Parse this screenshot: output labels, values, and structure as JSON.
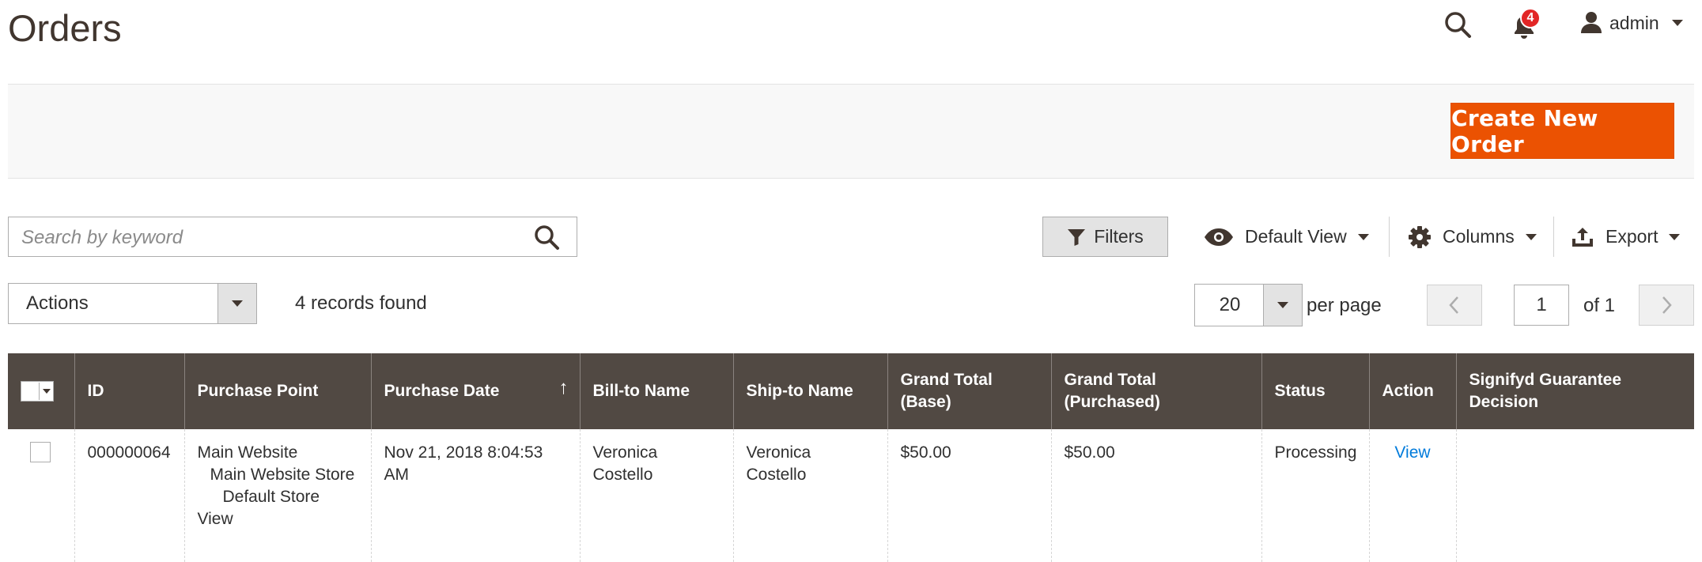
{
  "header": {
    "title": "Orders",
    "notifications_count": "4",
    "user_name": "admin"
  },
  "actions": {
    "create_button": "Create New Order"
  },
  "search": {
    "placeholder": "Search by keyword"
  },
  "toolbar": {
    "filters": "Filters",
    "view": "Default View",
    "columns": "Columns",
    "export": "Export"
  },
  "mass_actions": {
    "label": "Actions"
  },
  "records_found": "4 records found",
  "pager": {
    "per_page": "20",
    "per_page_label": "per page",
    "current_page": "1",
    "total_label": "of 1"
  },
  "grid": {
    "columns": [
      "ID",
      "Purchase Point",
      "Purchase Date",
      "Bill-to Name",
      "Ship-to Name",
      "Grand Total (Base)",
      "Grand Total (Purchased)",
      "Status",
      "Action",
      "Signifyd Guarantee Decision"
    ],
    "rows": [
      {
        "id": "000000064",
        "purchase_point": [
          "Main Website",
          "Main Website Store",
          "Default Store",
          "View"
        ],
        "purchase_date": "Nov 21, 2018 8:04:53 AM",
        "bill_to": "Veronica Costello",
        "ship_to": "Veronica Costello",
        "grand_total_base": "$50.00",
        "grand_total_purchased": "$50.00",
        "status": "Processing",
        "action": "View",
        "signifyd": ""
      }
    ]
  },
  "colors": {
    "accent": "#eb5202",
    "grid_header": "#514943",
    "link": "#007bdb",
    "badge": "#e22626"
  }
}
